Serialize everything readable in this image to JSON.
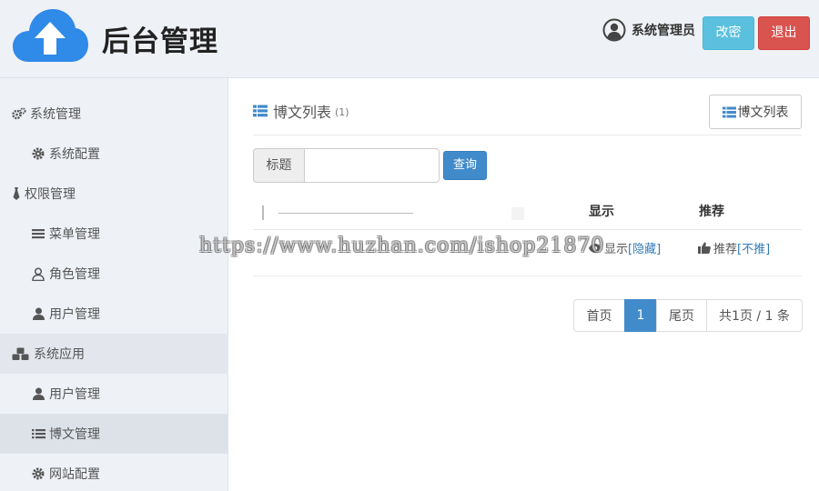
{
  "header": {
    "brand": "后台管理",
    "user_name": "系统管理员",
    "change_password_label": "改密",
    "logout_label": "退出"
  },
  "sidebar": {
    "items": [
      {
        "label": "系统管理",
        "icon": "cogs-icon",
        "level": "parent"
      },
      {
        "label": "系统配置",
        "icon": "gear-icon",
        "level": "child"
      },
      {
        "label": "权限管理",
        "icon": "tie-icon",
        "level": "parent"
      },
      {
        "label": "菜单管理",
        "icon": "bars-icon",
        "level": "child"
      },
      {
        "label": "角色管理",
        "icon": "user-outline-icon",
        "level": "child"
      },
      {
        "label": "用户管理",
        "icon": "user-icon",
        "level": "child"
      },
      {
        "label": "系统应用",
        "icon": "cubes-icon",
        "level": "parent"
      },
      {
        "label": "用户管理",
        "icon": "user-icon",
        "level": "child"
      },
      {
        "label": "博文管理",
        "icon": "list-icon",
        "level": "child",
        "active": true
      },
      {
        "label": "网站配置",
        "icon": "gear-icon",
        "level": "child"
      }
    ]
  },
  "main": {
    "title": "博文列表",
    "count": "(1)",
    "list_button_label": "博文列表",
    "search": {
      "label": "标题",
      "value": "",
      "button_label": "查询"
    },
    "table": {
      "headers": {
        "show": "显示",
        "recommend": "推荐"
      },
      "rows": [
        {
          "show_text": "显示",
          "show_action": "[隐藏]",
          "recommend_text": "推荐",
          "recommend_action": "[不推]"
        }
      ]
    },
    "pagination": {
      "first": "首页",
      "current": "1",
      "last": "尾页",
      "summary": "共1页 / 1 条"
    }
  },
  "watermark": "https://www.huzhan.com/ishop21870",
  "colors": {
    "info": "#5bc0de",
    "danger": "#d9534f",
    "primary": "#428bca",
    "sidebar_bg": "#eef1f6",
    "logo_blue": "#2f8ae8"
  }
}
